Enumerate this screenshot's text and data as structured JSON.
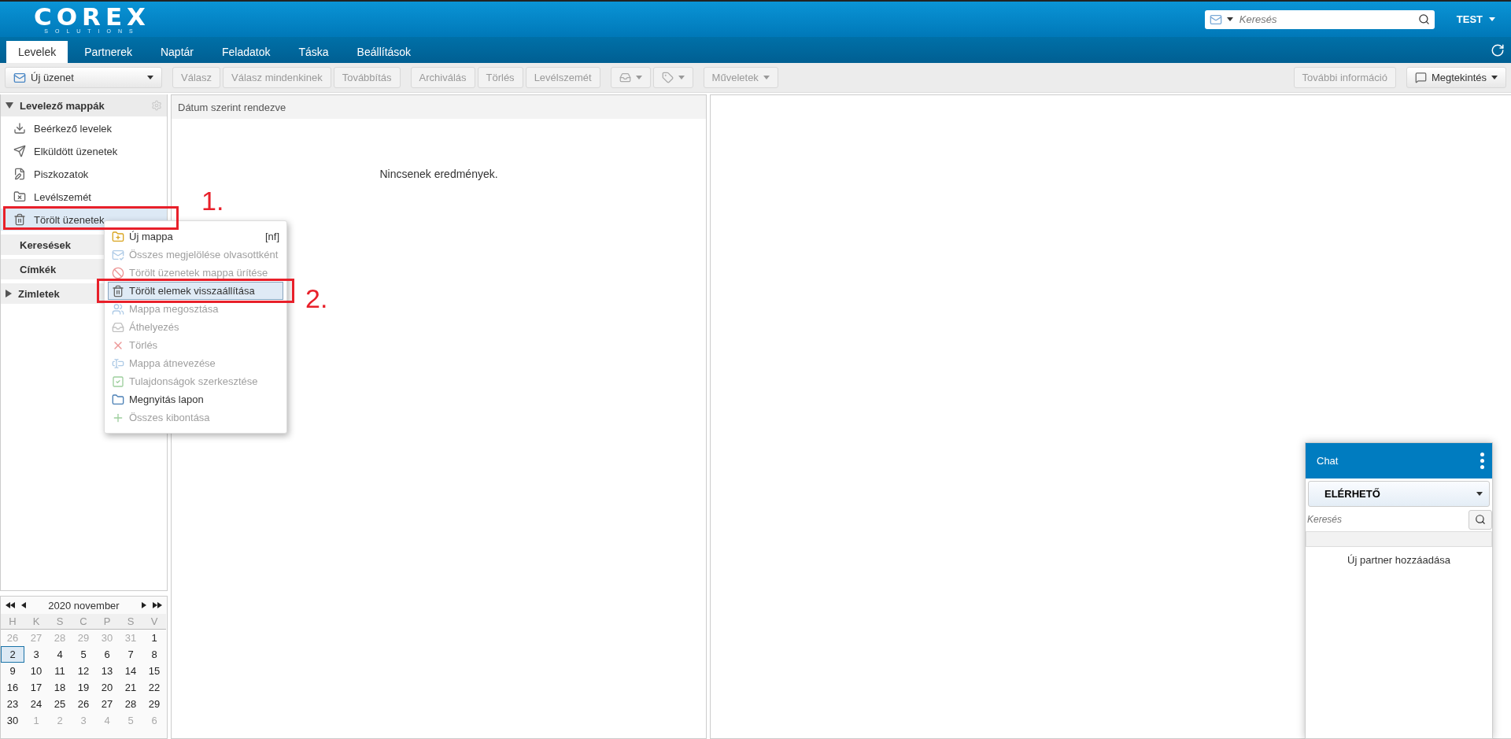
{
  "header": {
    "logo": "COREX",
    "tagline": "SOLUTIONS",
    "search": {
      "placeholder": "Keresés"
    },
    "user": "TEST"
  },
  "tabs": [
    {
      "label": "Levelek",
      "selected": true
    },
    {
      "label": "Partnerek",
      "selected": false
    },
    {
      "label": "Naptár",
      "selected": false
    },
    {
      "label": "Feladatok",
      "selected": false
    },
    {
      "label": "Táska",
      "selected": false
    },
    {
      "label": "Beállítások",
      "selected": false
    }
  ],
  "toolbar": {
    "new_message": {
      "label": "Új üzenet"
    },
    "buttons": [
      {
        "kind": "text",
        "label": "Válasz",
        "disabled": true
      },
      {
        "kind": "text",
        "label": "Válasz mindenkinek",
        "disabled": true
      },
      {
        "kind": "text",
        "label": "Továbbítás",
        "disabled": true
      },
      {
        "kind": "text",
        "label": "Archiválás",
        "disabled": true
      },
      {
        "kind": "text",
        "label": "Törlés",
        "disabled": true
      },
      {
        "kind": "text",
        "label": "Levélszemét",
        "disabled": true
      },
      {
        "kind": "icon",
        "disabled": true
      },
      {
        "kind": "icon",
        "disabled": true
      },
      {
        "kind": "menu",
        "label": "Műveletek",
        "disabled": true
      }
    ],
    "right": [
      {
        "kind": "text",
        "label": "További információ",
        "disabled": true
      },
      {
        "kind": "menu",
        "label": "Megtekintés",
        "disabled": false
      }
    ]
  },
  "sidebar": {
    "folders_header": {
      "label": "Levelező mappák",
      "expanded": true
    },
    "folders": [
      {
        "label": "Beérkező levelek",
        "selected": false
      },
      {
        "label": "Elküldött üzenetek",
        "selected": false
      },
      {
        "label": "Piszkozatok",
        "selected": false
      },
      {
        "label": "Levélszemét",
        "selected": false
      },
      {
        "label": "Törölt üzenetek",
        "selected": true
      }
    ],
    "sections": [
      {
        "label": "Keresések",
        "kind": "plain"
      },
      {
        "label": "Címkék",
        "kind": "plain"
      },
      {
        "label": "Zimletek",
        "kind": "collapsible",
        "expanded": false
      }
    ]
  },
  "calendar": {
    "title": "2020 november",
    "weekdays": [
      "H",
      "K",
      "S",
      "C",
      "P",
      "S",
      "V"
    ],
    "days": [
      {
        "day": "26",
        "other": true,
        "selected": false
      },
      {
        "day": "27",
        "other": true,
        "selected": false
      },
      {
        "day": "28",
        "other": true,
        "selected": false
      },
      {
        "day": "29",
        "other": true,
        "selected": false
      },
      {
        "day": "30",
        "other": true,
        "selected": false
      },
      {
        "day": "31",
        "other": true,
        "selected": false
      },
      {
        "day": "1",
        "other": false,
        "selected": false
      },
      {
        "day": "2",
        "other": false,
        "selected": true
      },
      {
        "day": "3",
        "other": false,
        "selected": false
      },
      {
        "day": "4",
        "other": false,
        "selected": false
      },
      {
        "day": "5",
        "other": false,
        "selected": false
      },
      {
        "day": "6",
        "other": false,
        "selected": false
      },
      {
        "day": "7",
        "other": false,
        "selected": false
      },
      {
        "day": "8",
        "other": false,
        "selected": false
      },
      {
        "day": "9",
        "other": false,
        "selected": false
      },
      {
        "day": "10",
        "other": false,
        "selected": false
      },
      {
        "day": "11",
        "other": false,
        "selected": false
      },
      {
        "day": "12",
        "other": false,
        "selected": false
      },
      {
        "day": "13",
        "other": false,
        "selected": false
      },
      {
        "day": "14",
        "other": false,
        "selected": false
      },
      {
        "day": "15",
        "other": false,
        "selected": false
      },
      {
        "day": "16",
        "other": false,
        "selected": false
      },
      {
        "day": "17",
        "other": false,
        "selected": false
      },
      {
        "day": "18",
        "other": false,
        "selected": false
      },
      {
        "day": "19",
        "other": false,
        "selected": false
      },
      {
        "day": "20",
        "other": false,
        "selected": false
      },
      {
        "day": "21",
        "other": false,
        "selected": false
      },
      {
        "day": "22",
        "other": false,
        "selected": false
      },
      {
        "day": "23",
        "other": false,
        "selected": false
      },
      {
        "day": "24",
        "other": false,
        "selected": false
      },
      {
        "day": "25",
        "other": false,
        "selected": false
      },
      {
        "day": "26",
        "other": false,
        "selected": false
      },
      {
        "day": "27",
        "other": false,
        "selected": false
      },
      {
        "day": "28",
        "other": false,
        "selected": false
      },
      {
        "day": "29",
        "other": false,
        "selected": false
      },
      {
        "day": "30",
        "other": false,
        "selected": false
      },
      {
        "day": "1",
        "other": true,
        "selected": false
      },
      {
        "day": "2",
        "other": true,
        "selected": false
      },
      {
        "day": "3",
        "other": true,
        "selected": false
      },
      {
        "day": "4",
        "other": true,
        "selected": false
      },
      {
        "day": "5",
        "other": true,
        "selected": false
      },
      {
        "day": "6",
        "other": true,
        "selected": false
      }
    ]
  },
  "message_list": {
    "sort_label": "Dátum szerint rendezve",
    "empty": "Nincsenek eredmények."
  },
  "context_menu": [
    {
      "label": "Új mappa",
      "shortcut": "[nf]",
      "disabled": false,
      "selected": false
    },
    {
      "label": "Összes megjelölése olvasottként",
      "disabled": true,
      "selected": false
    },
    {
      "label": "Törölt üzenetek mappa ürítése",
      "disabled": true,
      "selected": false
    },
    {
      "label": "Törölt elemek visszaállítása",
      "disabled": false,
      "selected": true
    },
    {
      "label": "Mappa megosztása",
      "disabled": true,
      "selected": false
    },
    {
      "label": "Áthelyezés",
      "disabled": true,
      "selected": false
    },
    {
      "label": "Törlés",
      "disabled": true,
      "selected": false
    },
    {
      "label": "Mappa átnevezése",
      "disabled": true,
      "selected": false
    },
    {
      "label": "Tulajdonságok szerkesztése",
      "disabled": true,
      "selected": false
    },
    {
      "label": "Megnyitás lapon",
      "disabled": false,
      "selected": false
    },
    {
      "label": "Összes kibontása",
      "disabled": true,
      "selected": false
    }
  ],
  "chat": {
    "title": "Chat",
    "status": "ELÉRHETŐ",
    "search": {
      "placeholder": "Keresés"
    },
    "add_partner": "Új partner hozzáadása"
  },
  "annotations": [
    {
      "label": "1."
    },
    {
      "label": "2."
    }
  ]
}
